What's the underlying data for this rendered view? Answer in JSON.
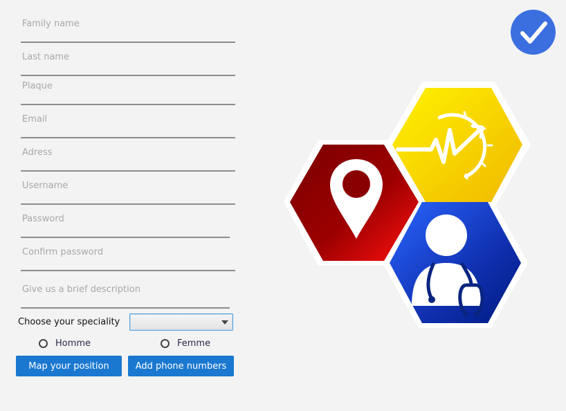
{
  "form": {
    "fields": [
      {
        "placeholder": "Family name",
        "value": ""
      },
      {
        "placeholder": "Last name",
        "value": ""
      },
      {
        "placeholder": "Plaque",
        "value": ""
      },
      {
        "placeholder": "Email",
        "value": ""
      },
      {
        "placeholder": "Adress",
        "value": ""
      },
      {
        "placeholder": "Username",
        "value": ""
      },
      {
        "placeholder": "Password",
        "value": ""
      },
      {
        "placeholder": "Confirm password",
        "value": ""
      },
      {
        "placeholder": "Give us a brief description",
        "value": ""
      }
    ],
    "speciality": {
      "label": "Choose your speciality",
      "selected": ""
    },
    "gender_options": [
      {
        "label": "Homme",
        "checked": false
      },
      {
        "label": "Femme",
        "checked": false
      }
    ],
    "buttons": {
      "map_position": "Map your position",
      "add_phone": "Add phone numbers"
    }
  },
  "confirm_button": {
    "icon": "checkmark-icon"
  },
  "logo": {
    "icon": "medical-hexagon-logo"
  },
  "colors": {
    "button_blue": "#1a78d0",
    "confirm_blue": "#3b6fe0",
    "hex_red": "#b00000",
    "hex_yellow": "#f5d000",
    "hex_blue": "#1c3fb5"
  }
}
